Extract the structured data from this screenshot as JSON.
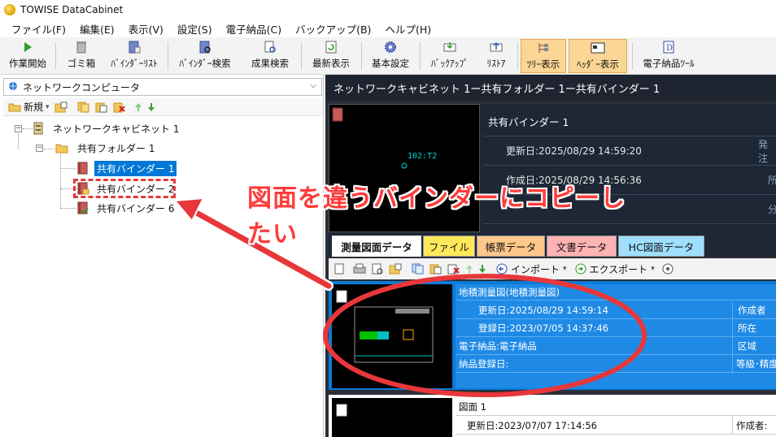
{
  "window": {
    "title": "TOWISE DataCabinet"
  },
  "menu": [
    "ファイル(F)",
    "編集(E)",
    "表示(V)",
    "設定(S)",
    "電子納品(C)",
    "バックアップ(B)",
    "ヘルプ(H)"
  ],
  "toolbar": {
    "buttons": [
      {
        "label": "作業開始",
        "icon": "play-icon"
      },
      {
        "label": "ゴミ箱",
        "icon": "trash-icon"
      },
      {
        "label": "ﾊﾞｲﾝﾀﾞｰﾘｽﾄ",
        "icon": "binder-list-icon"
      },
      {
        "label": "ﾊﾞｲﾝﾀﾞｰ検索",
        "icon": "binder-search-icon"
      },
      {
        "label": "成果検索",
        "icon": "result-search-icon"
      },
      {
        "label": "最新表示",
        "icon": "refresh-icon"
      },
      {
        "label": "基本設定",
        "icon": "gear-icon"
      },
      {
        "label": "ﾊﾞｯｸｱｯﾌﾟ",
        "icon": "backup-icon"
      },
      {
        "label": "ﾘｽﾄｱ",
        "icon": "restore-icon"
      },
      {
        "label": "ﾂﾘｰ表示",
        "icon": "tree-view-icon"
      },
      {
        "label": "ﾍｯﾀﾞｰ表示",
        "icon": "header-view-icon"
      },
      {
        "label": "電子納品ﾂｰﾙ",
        "icon": "delivery-tool-icon"
      }
    ]
  },
  "left": {
    "location": "ネットワークコンピュータ",
    "new_label": "新規",
    "tree": {
      "cabinet": "ネットワークキャビネット 1",
      "folder": "共有フォルダー 1",
      "binders": [
        "共有バインダー 1",
        "共有バインダー 2",
        "共有バインダー 6"
      ]
    }
  },
  "right": {
    "breadcrumb": "ネットワークキャビネット 1ー共有フォルダー 1ー共有バインダー 1",
    "binder_name": "共有バインダー 1",
    "updated": "更新日:2025/08/29 14:59:20",
    "created": "作成日:2025/08/29 14:56:36",
    "side_labels": [
      "発注",
      "所",
      "分"
    ],
    "preview_text": "102:T2",
    "tabs": [
      "測量図面データ",
      "ファイル",
      "帳票データ",
      "文書データ",
      "HC図面データ"
    ],
    "tools": {
      "import": "インポート",
      "export": "エクスポート"
    },
    "items": [
      {
        "title": "地積測量図(地積測量図)",
        "updated": "更新日:2025/08/29 14:59:14",
        "registered": "登録日:2023/07/05 14:37:46",
        "delivery": "電子納品:電子納品",
        "reg_date": "納品登録日:",
        "right_labels": [
          "作成者",
          "所在",
          "区域",
          "等級･精度"
        ]
      },
      {
        "title": "図面 1",
        "updated": "更新日:2023/07/07 17:14:56",
        "right_label": "作成者:"
      }
    ]
  },
  "annotation": {
    "text": "図面を違うバインダーにコピーしたい",
    "color": "#ff3b3b"
  }
}
